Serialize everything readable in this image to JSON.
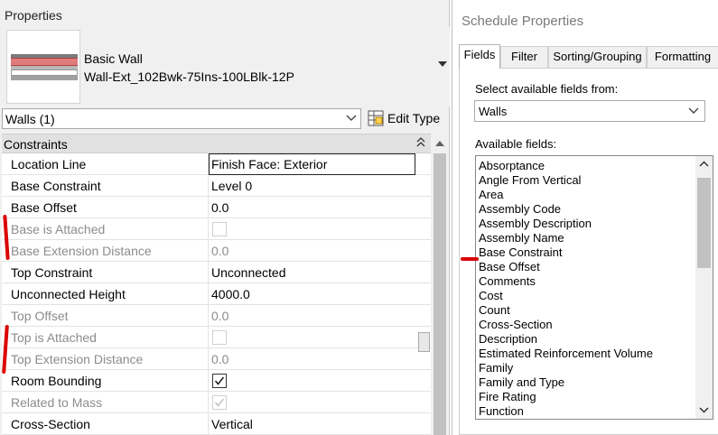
{
  "properties": {
    "title": "Properties",
    "type_family": "Basic Wall",
    "type_name": "Wall-Ext_102Bwk-75Ins-100LBlk-12P",
    "selector_label": "Walls (1)",
    "edit_type_label": "Edit Type",
    "group_label": "Constraints",
    "rows": [
      {
        "name": "Location Line",
        "value": "Finish Face: Exterior",
        "kind": "text",
        "enabled": true
      },
      {
        "name": "Base Constraint",
        "value": "Level 0",
        "kind": "text",
        "enabled": true
      },
      {
        "name": "Base Offset",
        "value": "0.0",
        "kind": "text",
        "enabled": true
      },
      {
        "name": "Base is Attached",
        "value": "",
        "kind": "checkbox",
        "checked": false,
        "enabled": false
      },
      {
        "name": "Base Extension Distance",
        "value": "0.0",
        "kind": "text",
        "enabled": false
      },
      {
        "name": "Top Constraint",
        "value": "Unconnected",
        "kind": "text",
        "enabled": true
      },
      {
        "name": "Unconnected Height",
        "value": "4000.0",
        "kind": "text",
        "enabled": true
      },
      {
        "name": "Top Offset",
        "value": "0.0",
        "kind": "text",
        "enabled": false
      },
      {
        "name": "Top is Attached",
        "value": "",
        "kind": "checkbox",
        "checked": false,
        "enabled": false
      },
      {
        "name": "Top Extension Distance",
        "value": "0.0",
        "kind": "text",
        "enabled": false
      },
      {
        "name": "Room Bounding",
        "value": "",
        "kind": "checkbox",
        "checked": true,
        "enabled": true
      },
      {
        "name": "Related to Mass",
        "value": "",
        "kind": "checkbox",
        "checked": true,
        "enabled": false
      },
      {
        "name": "Cross-Section",
        "value": "Vertical",
        "kind": "text",
        "enabled": true
      }
    ]
  },
  "schedule": {
    "title": "Schedule Properties",
    "tabs": [
      {
        "label": "Fields",
        "active": true
      },
      {
        "label": "Filter",
        "active": false
      },
      {
        "label": "Sorting/Grouping",
        "active": false
      },
      {
        "label": "Formatting",
        "active": false
      }
    ],
    "select_label": "Select available fields from:",
    "category_value": "Walls",
    "available_label": "Available fields:",
    "fields": [
      "Absorptance",
      "Angle From Vertical",
      "Area",
      "Assembly Code",
      "Assembly Description",
      "Assembly Name",
      "Base Constraint",
      "Base Offset",
      "Comments",
      "Cost",
      "Count",
      "Cross-Section",
      "Description",
      "Estimated Reinforcement Volume",
      "Family",
      "Family and Type",
      "Fire Rating",
      "Function"
    ]
  },
  "colors": {
    "annotation_red": "#d90000",
    "wall_pattern_red": "#e06060",
    "disabled_text": "#8c8c8c"
  },
  "icons": {
    "edit_type": "edit-type-icon",
    "collapse": "collapse-chevrons-icon",
    "dropdown": "chevron-down-icon"
  }
}
